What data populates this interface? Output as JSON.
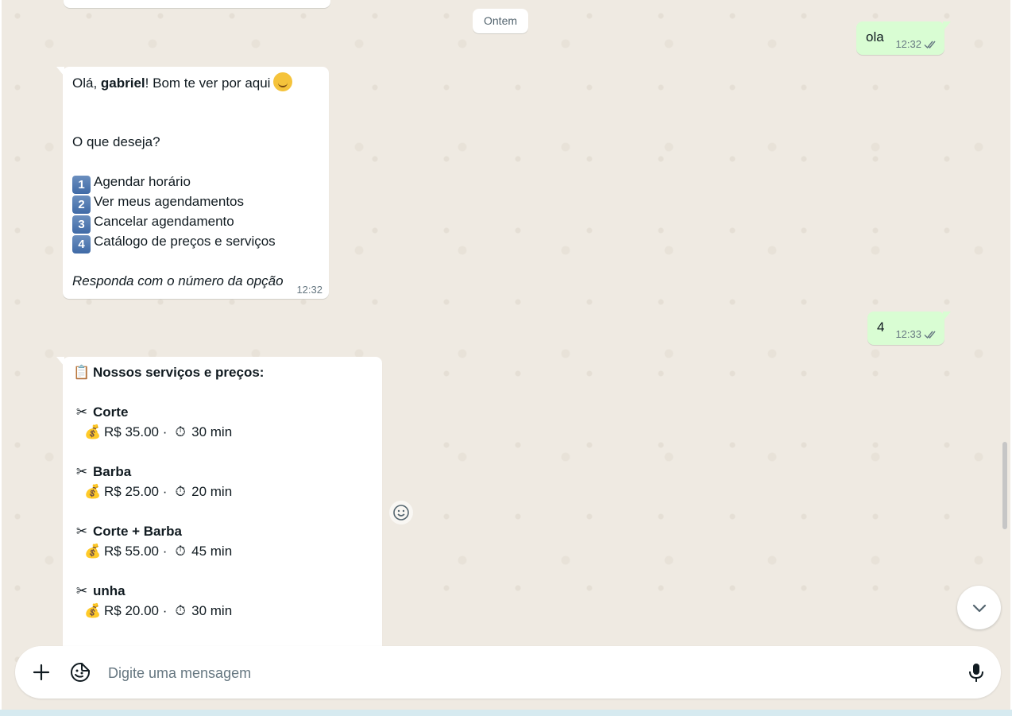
{
  "day_separator": "Ontem",
  "outgoing": [
    {
      "text": "ola",
      "time": "12:32"
    },
    {
      "text": "4",
      "time": "12:33"
    }
  ],
  "menu_message": {
    "greeting_prefix": "Olá, ",
    "greeting_name": "gabriel",
    "greeting_suffix": "! Bom te ver por aqui",
    "question": "O que deseja?",
    "options": [
      {
        "num": "1",
        "label": "Agendar horário"
      },
      {
        "num": "2",
        "label": "Ver meus agendamentos"
      },
      {
        "num": "3",
        "label": "Cancelar agendamento"
      },
      {
        "num": "4",
        "label": "Catálogo de preços e serviços"
      }
    ],
    "footer": "Responda com o número da opção",
    "time": "12:32"
  },
  "catalog_message": {
    "title": "Nossos serviços e preços:",
    "services": [
      {
        "name": "Corte",
        "price": "R$ 35.00",
        "duration": "30 min"
      },
      {
        "name": "Barba",
        "price": "R$ 25.00",
        "duration": "20 min"
      },
      {
        "name": "Corte + Barba",
        "price": "R$ 55.00",
        "duration": "45 min"
      },
      {
        "name": "unha",
        "price": "R$ 20.00",
        "duration": "30 min"
      }
    ],
    "separator": "·"
  },
  "composer": {
    "placeholder": "Digite uma mensagem"
  },
  "icons": {
    "attach": "plus-icon",
    "sticker": "sticker-icon",
    "mic": "mic-icon",
    "scroll_down": "chevron-down-icon",
    "react": "emoji-icon"
  },
  "colors": {
    "chat_bg": "#efeae2",
    "outgoing_bubble": "#d9fdd3",
    "incoming_bubble": "#ffffff",
    "read_ticks": "#53bdeb"
  }
}
